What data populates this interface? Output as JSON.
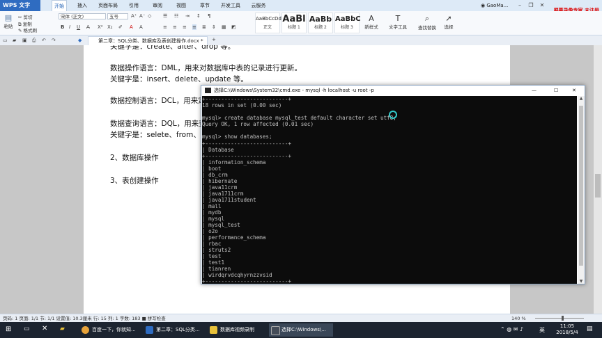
{
  "app": {
    "name": "WPS 文字",
    "menu_tabs": [
      "开始",
      "插入",
      "页面布局",
      "引用",
      "审阅",
      "视图",
      "章节",
      "开发工具",
      "云服务"
    ],
    "active_tab": "开始",
    "user": "GaoMa...",
    "watermark": "屏幕录像专家 未注册"
  },
  "ribbon": {
    "cut": "剪切",
    "paste": "粘贴",
    "copy": "复制",
    "format_painter": "格式刷",
    "font_name": "宋体 (正文)",
    "font_size": "五号",
    "styles": [
      {
        "sample": "AaBbCcDd",
        "label": "正文"
      },
      {
        "sample": "AaBl",
        "label": "标题 1"
      },
      {
        "sample": "AaBb",
        "label": "标题 2"
      },
      {
        "sample": "AaBbC",
        "label": "标题 3"
      }
    ],
    "new_style": "新样式",
    "text_tools": "文字工具",
    "find_replace": "查找替换",
    "select": "选择"
  },
  "document": {
    "tab_title": "第二章：SQL分类、数据库及表创建操作.docx *",
    "lines": [
      "关键字是：create、alter、drop 等。",
      "数据操作语言：DML，用来对数据库中表的记录进行更新。",
      "关键字是：insert、delete、update 等。",
      "数据控制语言：DCL，用来定",
      "数据查询语言：DQL，用来查",
      "关键字是：selete、from、w",
      "2、数据库操作",
      "3、表创建操作"
    ]
  },
  "cmd": {
    "title": "选择C:\\Windows\\System32\\cmd.exe - mysql  -h localhost -u root -p",
    "lines_top": [
      "18 rows in set (0.00 sec)",
      "",
      "mysql> create database mysql_test default character set utf8;",
      "Query OK, 1 row affected (0.01 sec)",
      "",
      "mysql> show databases;"
    ],
    "header": "Database",
    "databases": [
      "information_schema",
      "boot",
      "db_crm",
      "hibernate",
      "java11crm",
      "java1711crm",
      "java1711student",
      "mall",
      "mydb",
      "mysql",
      "mysql_test",
      "o2o",
      "performance_schema",
      "rbac",
      "struts2",
      "test",
      "test1",
      "tianren",
      "wirdqrvdcqhyrnzzvsid"
    ]
  },
  "status_bar": {
    "text": "页码: 1   页面: 1/1   节: 1/1   设置值: 10.3厘米  行: 15  列: 1   字数: 183   ■ 拼写检查",
    "zoom": "140 %"
  },
  "taskbar": {
    "items": [
      {
        "label": "百度一下，你就知...",
        "color": "#e8a33a"
      },
      {
        "label": "第二章：SQL分类...",
        "color": "#2f6cc1"
      },
      {
        "label": "数据库视频录制",
        "color": "#e8c13a"
      },
      {
        "label": "选择C:\\Windows\\...",
        "color": "#444c58"
      }
    ],
    "time": "11:05",
    "date": "2018/5/4",
    "ime": "英"
  }
}
